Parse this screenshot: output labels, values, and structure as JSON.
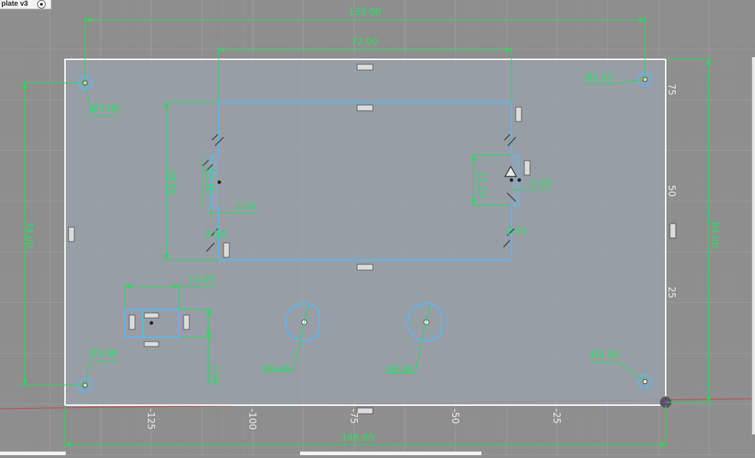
{
  "tab": {
    "label": "plate v3"
  },
  "dimensions": {
    "overall_width": "138.00",
    "slot_width": "72.00",
    "total_width": "148.00",
    "left_height": "74.00",
    "right_height": "84.00",
    "slot_height": "39.00",
    "left_notch": "12.20",
    "right_notch": "12.20",
    "notch_depth_left": "2.00",
    "notch_depth_right": "2.00",
    "small_left": "2.00",
    "small_right": "2.00",
    "connector_width": "13.20",
    "connector_offset": "7.00",
    "hole_tl": "Ø3.00",
    "hole_tr": "Ø3.00",
    "hole_bl": "Ø3.00",
    "hole_br": "Ø3.00",
    "circle_left": "Ø9.45",
    "circle_right": "Ø9.45"
  },
  "ruler": {
    "vertical": [
      "75",
      "50",
      "25"
    ],
    "horizontal": [
      "-125",
      "-100",
      "-75",
      "-50",
      "-25"
    ]
  },
  "colors": {
    "canvas": "#8e8e8e",
    "grid": "#9d9d9d",
    "plate_fill": "#9aa3ad",
    "sketch_line": "#5cb6ee",
    "dimension": "#1fe055",
    "outline": "#ffffff"
  }
}
